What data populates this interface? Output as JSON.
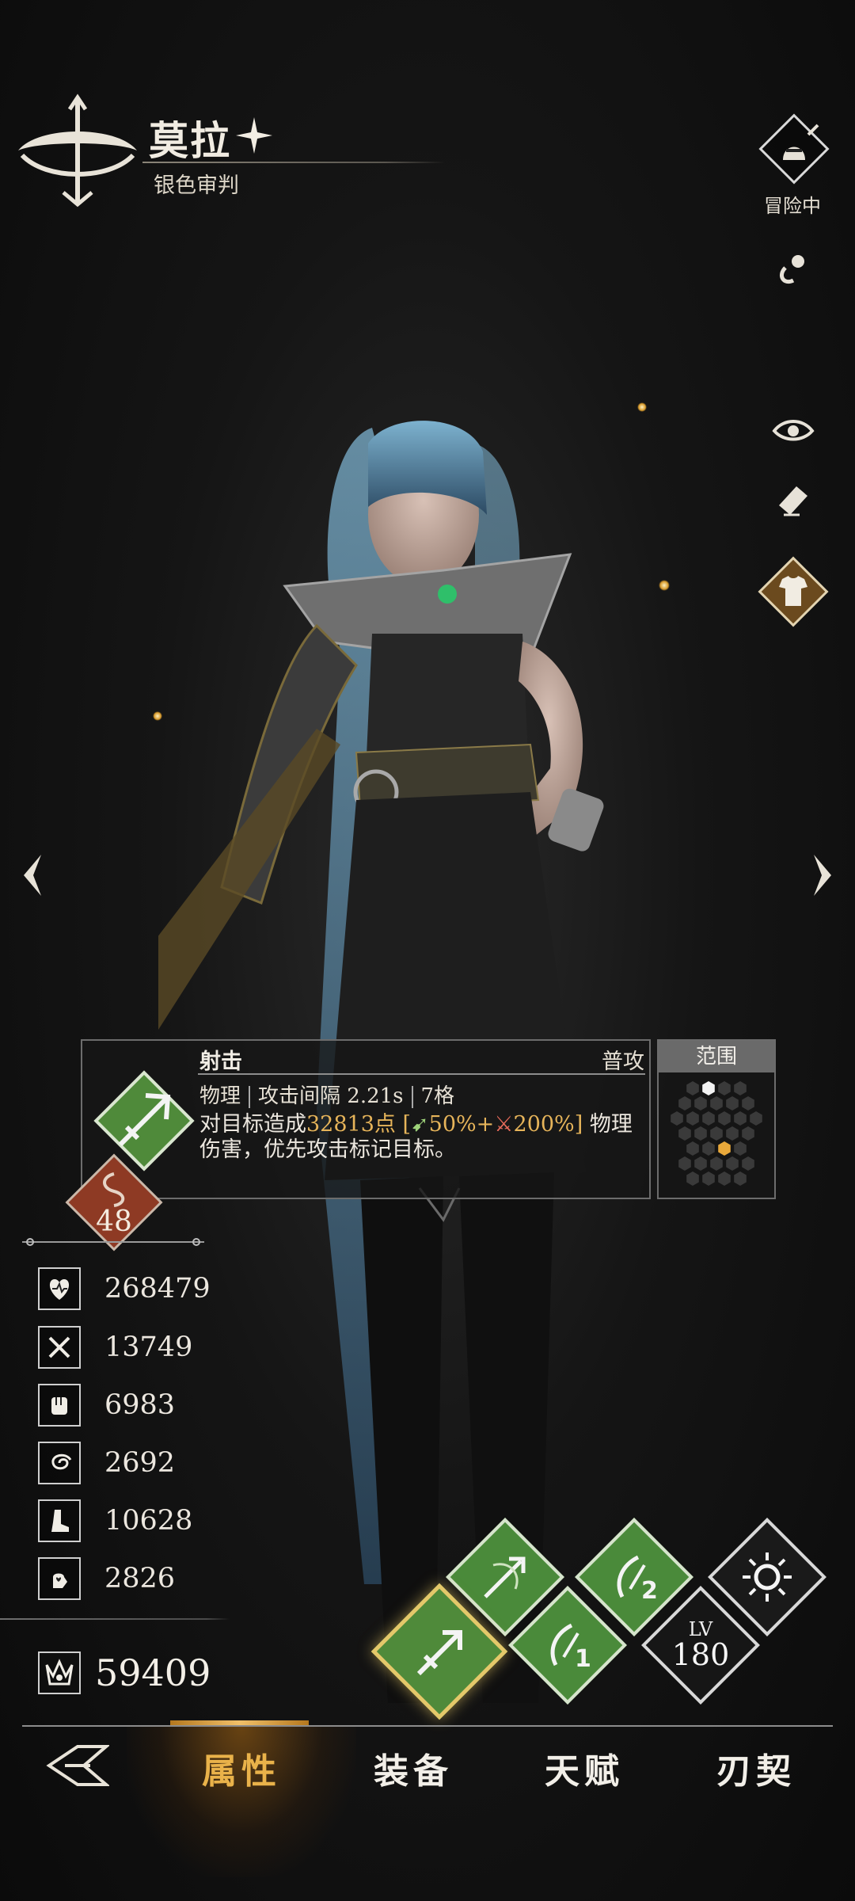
{
  "header": {
    "name": "莫拉",
    "title": "银色审判"
  },
  "right_panel": {
    "status_label": "冒险中"
  },
  "skill": {
    "name": "射击",
    "type": "普攻",
    "damage_type": "物理",
    "attack_interval": "攻击间隔 2.21s",
    "range_cells": "7格",
    "desc_prefix": "对目标造成",
    "damage_value": "32813点",
    "bracket_open": " [",
    "green_pct": "50%+",
    "red_pct": "200%]",
    "desc_suffix": " 物理伤害，优先攻击标记目标。",
    "range_title": "范围"
  },
  "rank": {
    "value": "48"
  },
  "stats": [
    {
      "icon": "heart-icon",
      "value": "268479"
    },
    {
      "icon": "crossed-swords-icon",
      "value": "13749"
    },
    {
      "icon": "fist-icon",
      "value": "6983"
    },
    {
      "icon": "swirl-icon",
      "value": "2692"
    },
    {
      "icon": "boot-icon",
      "value": "10628"
    },
    {
      "icon": "hand-heart-icon",
      "value": "2826"
    }
  ],
  "power": {
    "value": "59409"
  },
  "skills_bar": {
    "level_prefix": "LV",
    "level_value": "180",
    "skill2_number": "2",
    "skill1_number": "1"
  },
  "nav": {
    "tabs": [
      "属性",
      "装备",
      "天赋",
      "刃契"
    ],
    "active": "属性"
  },
  "colors": {
    "accent_gold": "#e9b24a",
    "skill_green": "#4f8a3a",
    "rank_red": "#8e3a24"
  }
}
